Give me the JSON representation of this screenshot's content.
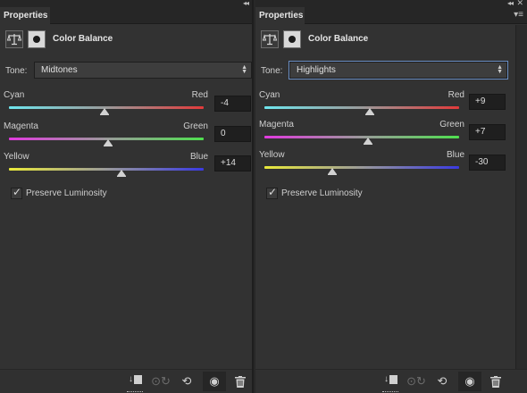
{
  "left_panel": {
    "tab": "Properties",
    "title": "Color Balance",
    "tone_label": "Tone:",
    "tone_value": "Midtones",
    "sliders": [
      {
        "left_label": "Cyan",
        "right_label": "Red",
        "value": "-4",
        "position_fraction": 0.49,
        "gradient": [
          "#6fe6ee",
          "#9a9a9a",
          "#e23a3a"
        ]
      },
      {
        "left_label": "Magenta",
        "right_label": "Green",
        "value": "0",
        "position_fraction": 0.51,
        "gradient": [
          "#e23ae0",
          "#9a9a9a",
          "#4fe04f"
        ]
      },
      {
        "left_label": "Yellow",
        "right_label": "Blue",
        "value": "+14",
        "position_fraction": 0.58,
        "gradient": [
          "#eaea3a",
          "#9a9a9a",
          "#3a3ae2"
        ]
      }
    ],
    "preserve_label": "Preserve Luminosity",
    "preserve_checked": true
  },
  "right_panel": {
    "tab": "Properties",
    "title": "Color Balance",
    "tone_label": "Tone:",
    "tone_value": "Highlights",
    "sliders": [
      {
        "left_label": "Cyan",
        "right_label": "Red",
        "value": "+9",
        "position_fraction": 0.54,
        "gradient": [
          "#6fe6ee",
          "#9a9a9a",
          "#e23a3a"
        ]
      },
      {
        "left_label": "Magenta",
        "right_label": "Green",
        "value": "+7",
        "position_fraction": 0.53,
        "gradient": [
          "#e23ae0",
          "#9a9a9a",
          "#4fe04f"
        ]
      },
      {
        "left_label": "Yellow",
        "right_label": "Blue",
        "value": "-30",
        "position_fraction": 0.35,
        "gradient": [
          "#eaea3a",
          "#9a9a9a",
          "#3a3ae2"
        ]
      }
    ],
    "preserve_label": "Preserve Luminosity",
    "preserve_checked": true
  },
  "icons": {
    "collapse": "double-chevron-left-icon",
    "close": "close-icon",
    "panel_menu": "panel-menu-icon",
    "adjustment": "balance-scale-icon",
    "mask": "layer-mask-icon",
    "clip": "clip-to-layer-icon",
    "view_previous": "view-previous-state-icon",
    "reset": "reset-icon",
    "visibility": "eye-icon",
    "delete": "trash-icon"
  },
  "glyphs": {
    "collapse": "◂◂",
    "close": "✕",
    "panel_menu": "▾≡",
    "updown": "▲▼",
    "check": "✓",
    "view_previous": "👁",
    "reset": "⟲",
    "visibility": "◉",
    "delete": "🗑"
  }
}
